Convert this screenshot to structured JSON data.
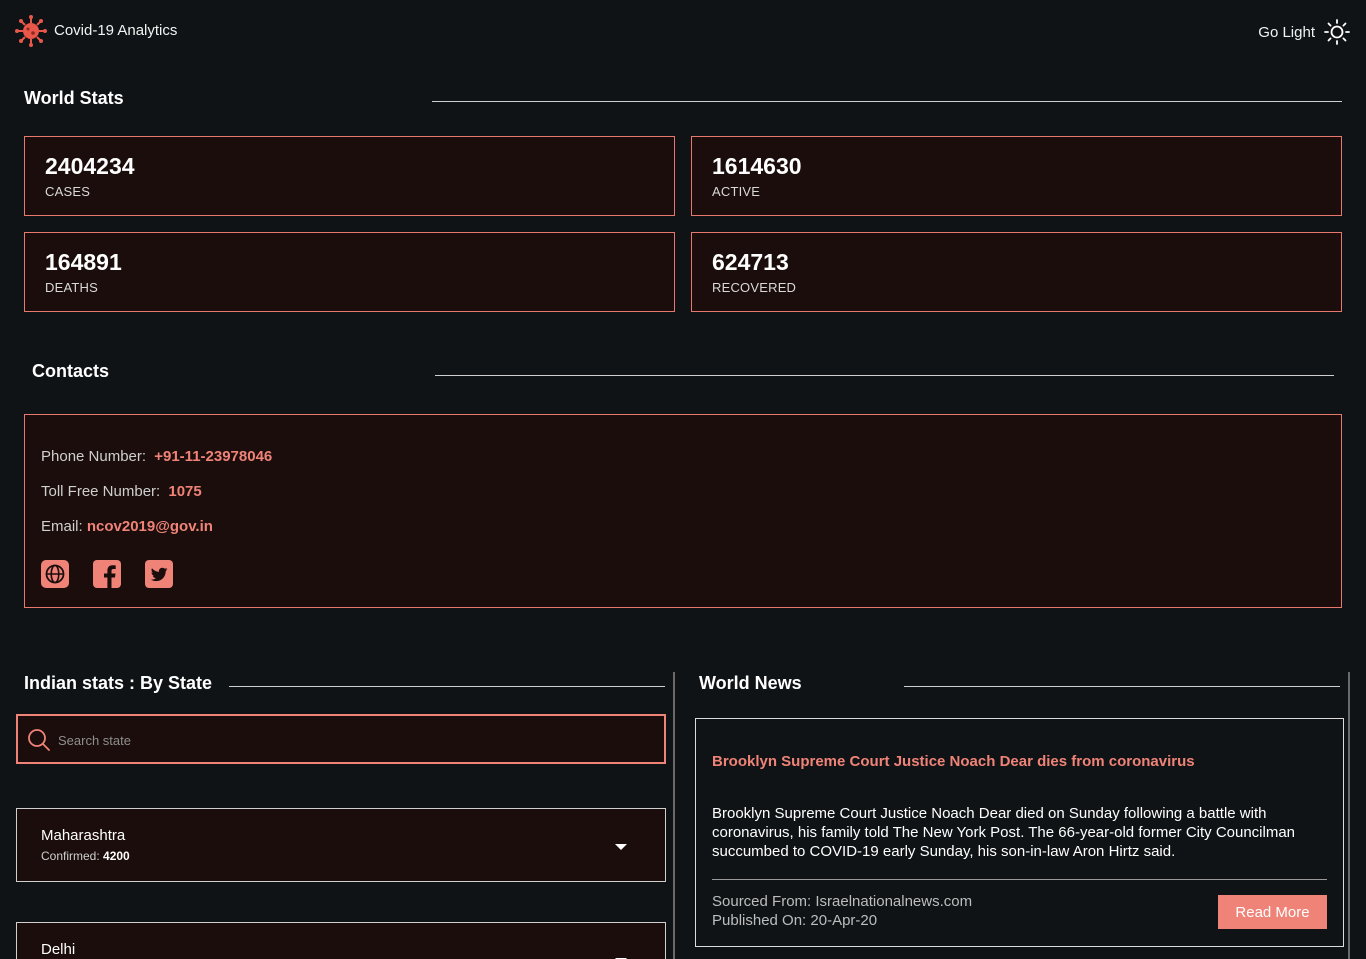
{
  "app": {
    "title": "Covid-19 Analytics",
    "logo_icon": "virus-icon",
    "theme_toggle_label": "Go Light",
    "theme_icon": "sun-icon"
  },
  "world_stats": {
    "title": "World Stats",
    "cards": [
      {
        "value": "2404234",
        "label": "CASES"
      },
      {
        "value": "1614630",
        "label": "ACTIVE"
      },
      {
        "value": "164891",
        "label": "DEATHS"
      },
      {
        "value": "624713",
        "label": "RECOVERED"
      }
    ]
  },
  "contacts": {
    "title": "Contacts",
    "phone_label": "Phone Number:",
    "phone_value": "+91-11-23978046",
    "tollfree_label": "Toll Free Number:",
    "tollfree_value": "1075",
    "email_label": "Email:",
    "email_value": "ncov2019@gov.in",
    "social_icons": [
      "globe-icon",
      "facebook-icon",
      "twitter-icon"
    ]
  },
  "indian_stats": {
    "title": "Indian stats : By State",
    "search_placeholder": "Search state",
    "confirmed_label": "Confirmed:",
    "states": [
      {
        "name": "Maharashtra",
        "confirmed": "4200"
      },
      {
        "name": "Delhi",
        "confirmed": ""
      }
    ]
  },
  "world_news": {
    "title": "World News",
    "article": {
      "headline": "Brooklyn Supreme Court Justice Noach Dear dies from coronavirus",
      "body": "Brooklyn Supreme Court Justice Noach Dear died on Sunday following a battle with coronavirus, his family told The New York Post. The 66-year-old former City Councilman succumbed to COVID-19 early Sunday, his son-in-law Aron Hirtz said.",
      "source": "Sourced From: Israelnationalnews.com",
      "published": "Published On: 20-Apr-20",
      "read_more_label": "Read More"
    }
  },
  "colors": {
    "accent": "#f08378",
    "card_bg": "#1a0d0b",
    "page_bg": "#0f1316"
  }
}
